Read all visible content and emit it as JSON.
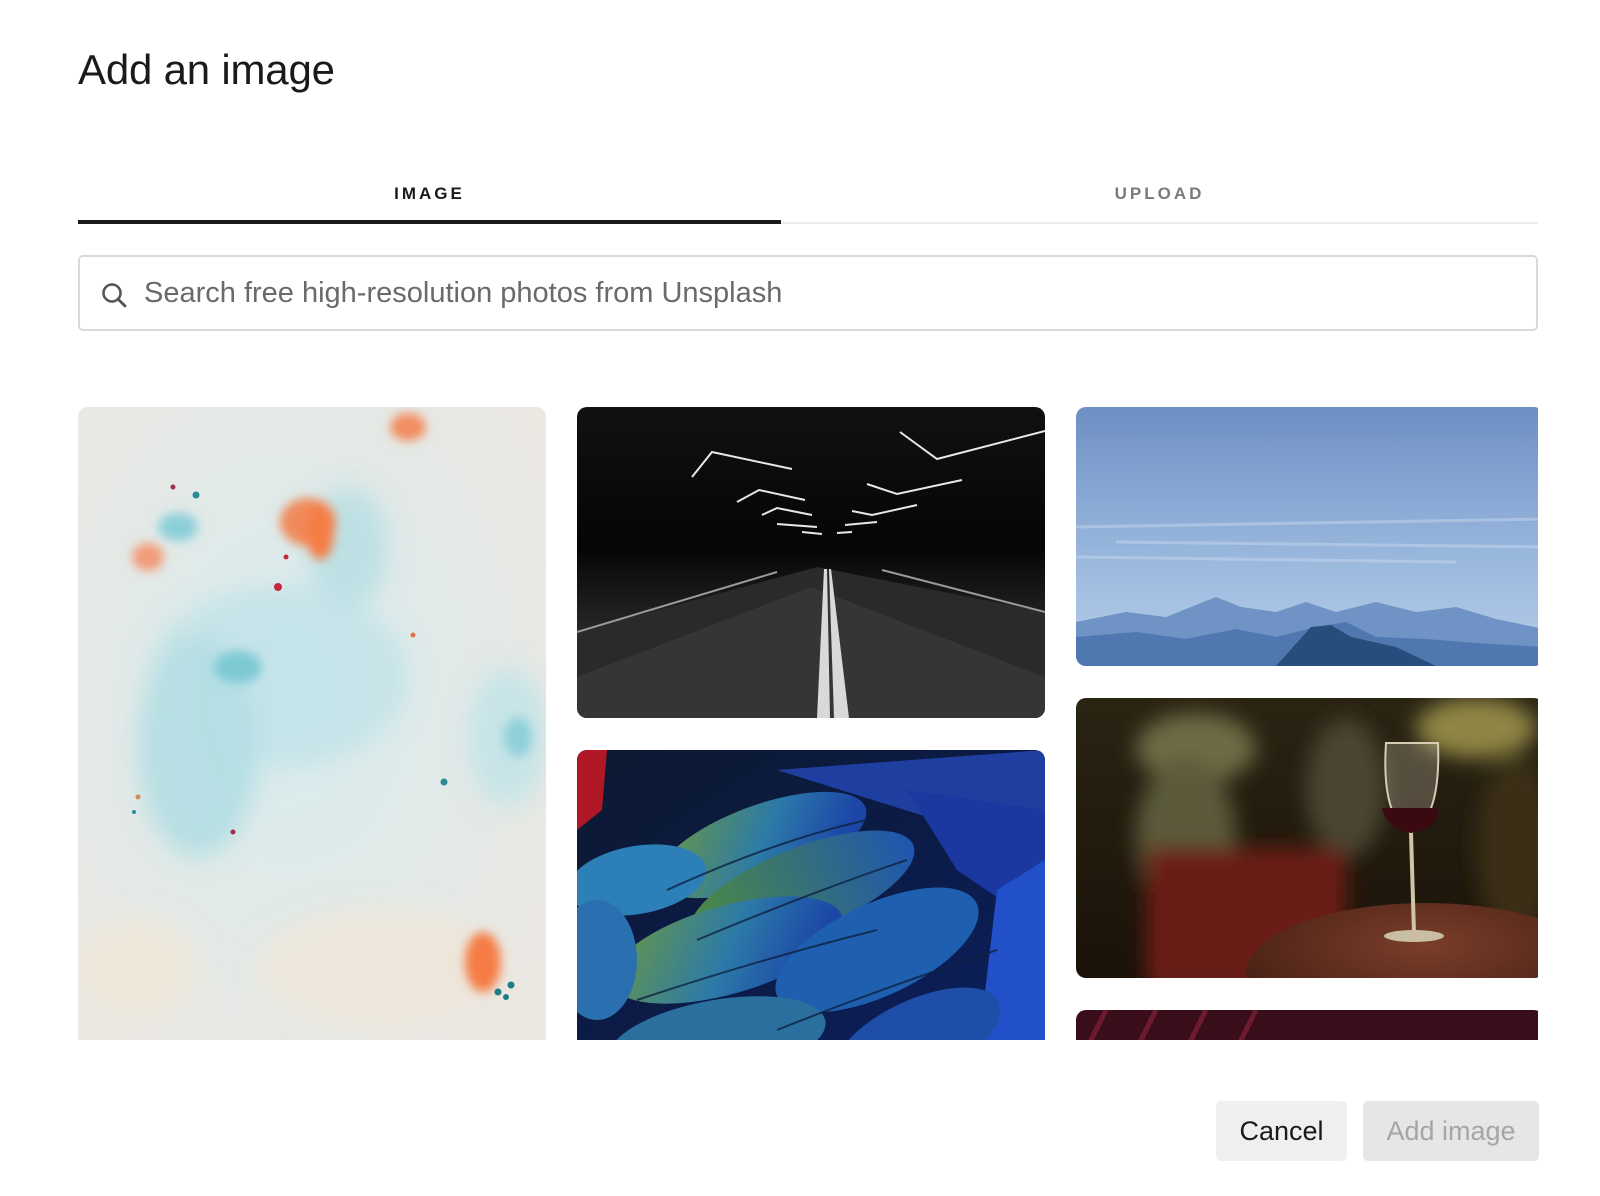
{
  "dialog": {
    "title": "Add an image"
  },
  "tabs": [
    {
      "label": "IMAGE",
      "active": true
    },
    {
      "label": "UPLOAD",
      "active": false
    }
  ],
  "search": {
    "placeholder": "Search free high-resolution photos from Unsplash",
    "value": "",
    "icon": "search-icon"
  },
  "gallery": {
    "photos": [
      {
        "name": "abstract-marble-paint"
      },
      {
        "name": "dark-tunnel-road"
      },
      {
        "name": "blue-mountains-sky"
      },
      {
        "name": "green-blue-feathers"
      },
      {
        "name": "wine-glass-table"
      },
      {
        "name": "dark-red-partial"
      }
    ]
  },
  "footer": {
    "cancel_label": "Cancel",
    "add_label": "Add image",
    "add_enabled": false
  },
  "colors": {
    "active_tab": "#1a1a1a",
    "inactive_tab": "#7a7a7a",
    "disabled_button_text": "#a5a5a5"
  }
}
